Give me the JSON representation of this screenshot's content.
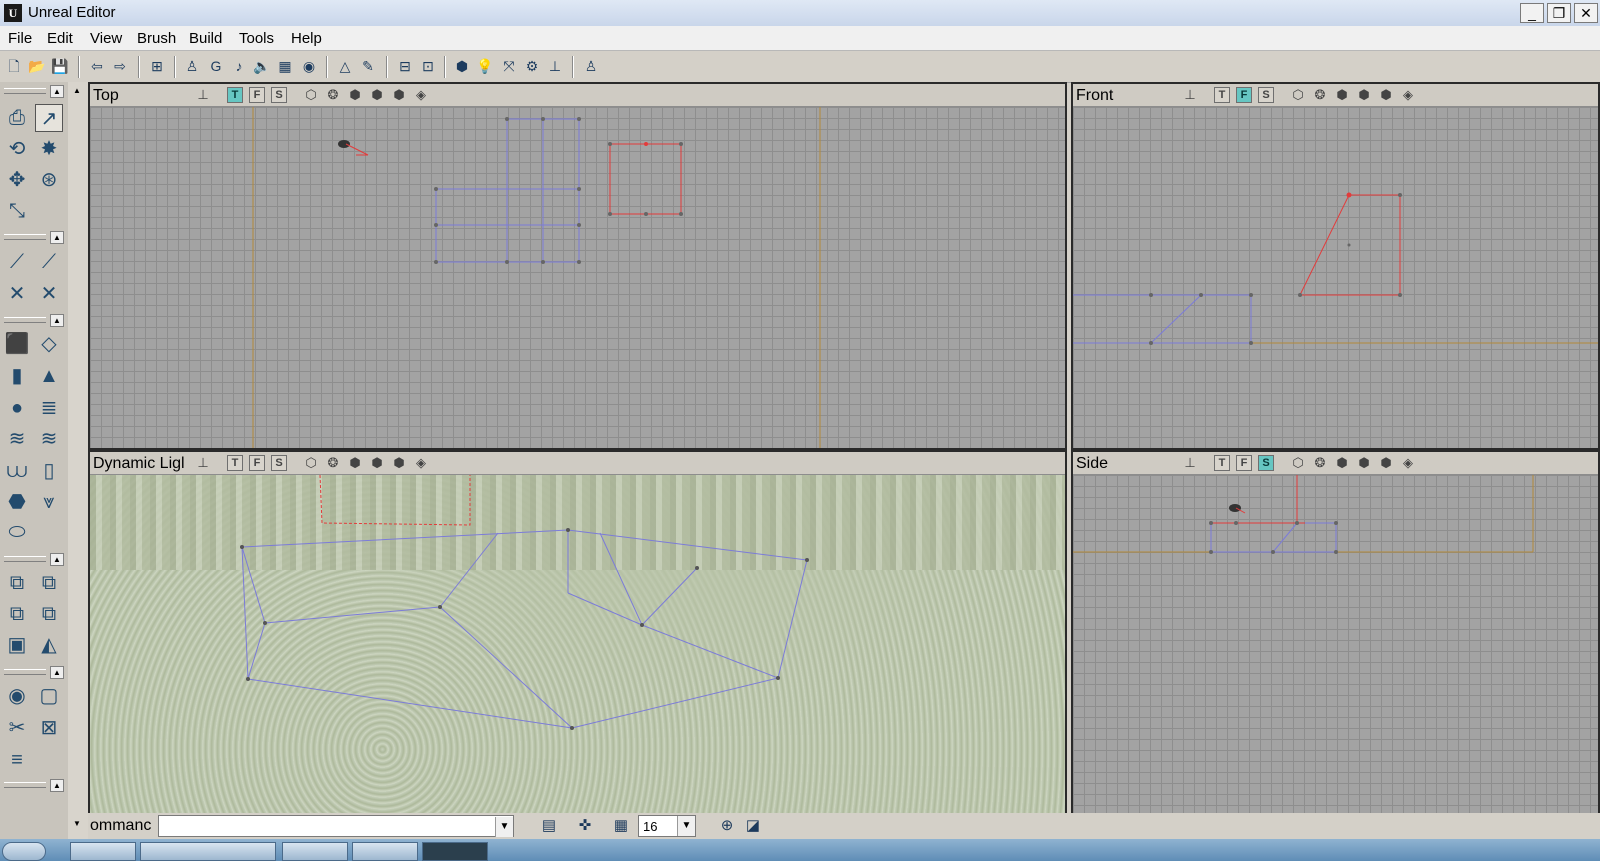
{
  "window": {
    "title": "Unreal Editor",
    "app_icon": "U",
    "controls": [
      "_",
      "❐",
      "✕"
    ]
  },
  "menu": [
    "File",
    "Edit",
    "View",
    "Brush",
    "Build",
    "Tools",
    "Help"
  ],
  "toolbar_icons": [
    {
      "name": "new-map-icon",
      "glyph": "🗋"
    },
    {
      "name": "open-icon",
      "glyph": "📂"
    },
    {
      "name": "save-icon",
      "glyph": "💾"
    },
    {
      "name": "undo-icon",
      "glyph": "⇦"
    },
    {
      "name": "redo-icon",
      "glyph": "⇨"
    },
    {
      "name": "find-actor-icon",
      "glyph": "⊞"
    },
    {
      "name": "actor-browser-icon",
      "glyph": "♙"
    },
    {
      "name": "group-browser-icon",
      "glyph": "G"
    },
    {
      "name": "music-browser-icon",
      "glyph": "♪"
    },
    {
      "name": "sound-browser-icon",
      "glyph": "🔈"
    },
    {
      "name": "texture-browser-icon",
      "glyph": "▦"
    },
    {
      "name": "mesh-browser-icon",
      "glyph": "◉"
    },
    {
      "name": "2d-shape-editor-icon",
      "glyph": "△"
    },
    {
      "name": "unrealscript-icon",
      "glyph": "✎"
    },
    {
      "name": "build-geometry-icon",
      "glyph": "⊟"
    },
    {
      "name": "build-lighting-icon",
      "glyph": "⊡"
    },
    {
      "name": "build-paths-icon",
      "glyph": "⬢"
    },
    {
      "name": "light-icon",
      "glyph": "💡"
    },
    {
      "name": "rebuild-icon",
      "glyph": "⤧"
    },
    {
      "name": "build-all-icon",
      "glyph": "⚙"
    },
    {
      "name": "build-options-icon",
      "glyph": "⊥"
    },
    {
      "name": "play-level-icon",
      "glyph": "♙"
    }
  ],
  "viewports": {
    "top": {
      "title": "Top",
      "buttons": [
        "T",
        "F",
        "S"
      ],
      "active": "T"
    },
    "front": {
      "title": "Front",
      "buttons": [
        "T",
        "F",
        "S"
      ],
      "active": "F"
    },
    "persp": {
      "title": "Dynamic Ligl",
      "buttons": [
        "T",
        "F",
        "S"
      ],
      "active": ""
    },
    "side": {
      "title": "Side",
      "buttons": [
        "T",
        "F",
        "S"
      ],
      "active": "S"
    }
  },
  "bottombar": {
    "command_label": "ommanc",
    "command_value": "",
    "grid_size": "16"
  },
  "colors": {
    "builder_brush": "#e33b3b",
    "geometry": "#7b7bd9",
    "axis": "#b38a3a",
    "active_button": "#66c6c2"
  }
}
